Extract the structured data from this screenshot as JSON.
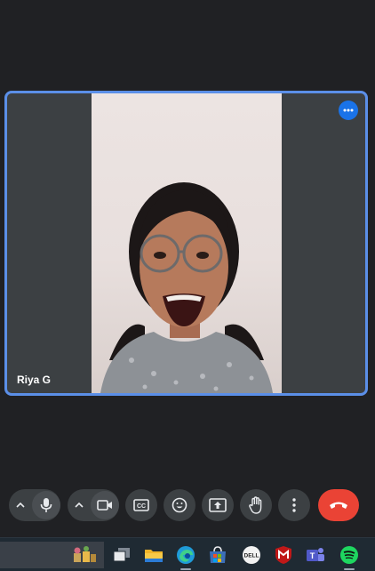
{
  "participant": {
    "name": "Riya G"
  },
  "controls": {
    "mic": "mic-icon",
    "camera": "camera-icon",
    "captions": "CC",
    "emoji": "emoji-icon",
    "present": "present-icon",
    "raise_hand": "hand-icon",
    "more": "more-vert-icon",
    "end_call": "end-call-icon"
  },
  "taskbar": {
    "apps": [
      "widgets",
      "task-view",
      "file-explorer",
      "edge",
      "microsoft-store",
      "dell",
      "mcafee",
      "teams",
      "spotify"
    ]
  },
  "colors": {
    "accent": "#1a73e8",
    "tile_border": "#5b8fe8",
    "end_call": "#ea4335",
    "background": "#202124"
  }
}
